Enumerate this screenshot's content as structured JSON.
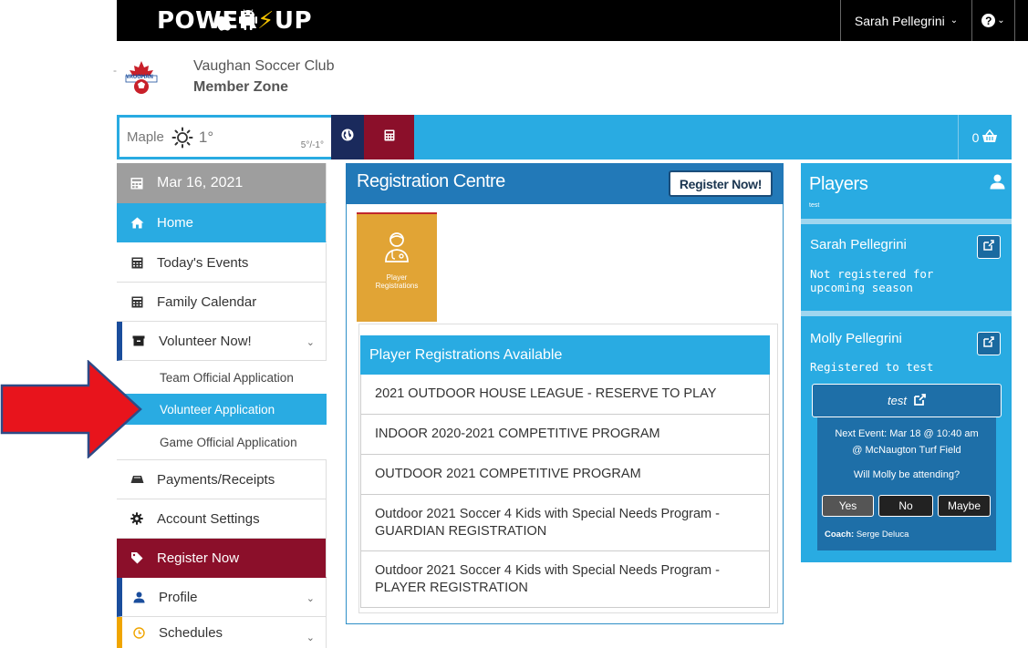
{
  "topbar": {
    "logo_left": "POWER",
    "logo_bolt": "⚡",
    "logo_right": "UP",
    "user_name": "Sarah Pellegrini",
    "help_label": "?"
  },
  "club": {
    "dash": "-",
    "name": "Vaughan Soccer Club",
    "zone": "Member Zone",
    "logo_text": "VAUGHAN"
  },
  "weather": {
    "city": "Maple",
    "temp": "1°",
    "range": "5°/-1°"
  },
  "cart": {
    "count": "0"
  },
  "sidebar": {
    "date": "Mar 16, 2021",
    "items": {
      "home": "Home",
      "todays_events": "Today's Events",
      "family_calendar": "Family Calendar",
      "volunteer_now": "Volunteer Now!",
      "payments": "Payments/Receipts",
      "account_settings": "Account Settings",
      "register_now": "Register Now",
      "profile": "Profile",
      "schedules": "Schedules"
    },
    "volunteer_sub": {
      "team_official": "Team Official Application",
      "volunteer": "Volunteer Application",
      "game_official": "Game Official Application"
    }
  },
  "registration": {
    "title": "Registration Centre",
    "register_button": "Register Now!",
    "tile_label_1": "Player",
    "tile_label_2": "Registrations",
    "list_header": "Player Registrations Available",
    "programs": [
      "2021 OUTDOOR HOUSE LEAGUE - RESERVE TO PLAY",
      "INDOOR 2020-2021 COMPETITIVE PROGRAM",
      "OUTDOOR 2021 COMPETITIVE PROGRAM",
      "Outdoor 2021 Soccer 4 Kids with Special Needs Program - GUARDIAN REGISTRATION",
      "Outdoor 2021 Soccer 4 Kids with Special Needs Program - PLAYER REGISTRATION"
    ]
  },
  "players": {
    "title": "Players",
    "subtitle": "test",
    "list": [
      {
        "name": "Sarah Pellegrini",
        "status_1": "Not registered for",
        "status_2": "upcoming season"
      },
      {
        "name": "Molly Pellegrini",
        "status_1": "Registered to test"
      }
    ],
    "team_button": "test",
    "next_event_1": "Next Event: Mar 18 @ 10:40 am",
    "next_event_2": "@ McNaugton Turf Field",
    "attending_question": "Will Molly be attending?",
    "attend_yes": "Yes",
    "attend_no": "No",
    "attend_maybe": "Maybe",
    "coach_label": "Coach:",
    "coach_name": "Serge Deluca"
  },
  "colors": {
    "accent_blue": "#29abe2",
    "dark_blue": "#2279b8",
    "maroon": "#8b0f2a",
    "navy": "#1a2a5c",
    "arrow_red": "#e8141c",
    "tile_orange": "#e1a435"
  }
}
